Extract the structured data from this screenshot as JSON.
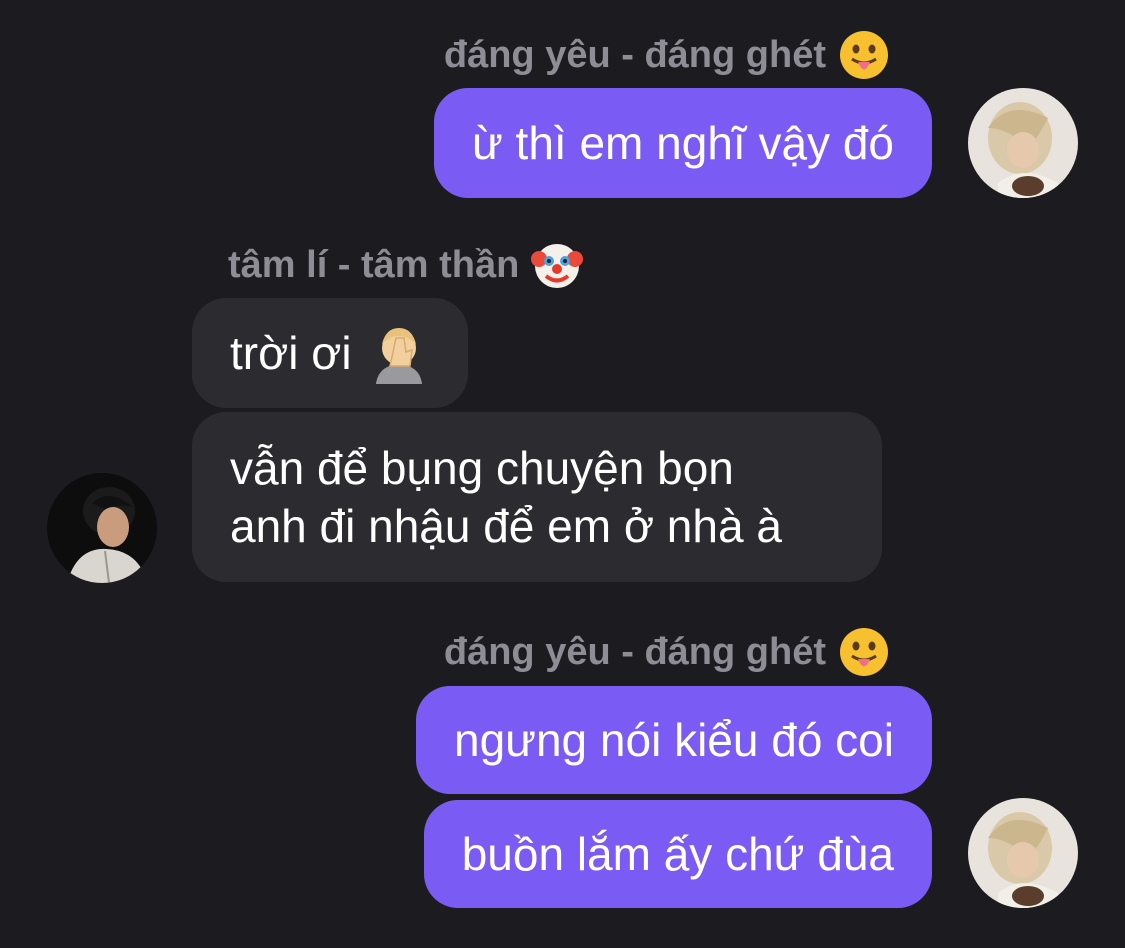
{
  "messages": [
    {
      "sender": "đáng yêu - đáng ghét",
      "sender_emoji": "face-with-tongue-emoji",
      "text": "ừ thì em nghĩ vậy đó"
    },
    {
      "sender": "tâm lí - tâm thần",
      "sender_emoji": "clown-face-emoji",
      "text": "trời ơi",
      "text_emoji": "face-palm-emoji"
    },
    {
      "text_line1": "vẫn để bụng chuyện bọn",
      "text_line2": "anh đi nhậu để em ở nhà à"
    },
    {
      "sender": "đáng yêu - đáng ghét",
      "sender_emoji": "face-with-tongue-emoji",
      "text": "ngưng nói kiểu đó coi"
    },
    {
      "text": "buồn lắm ấy chứ đùa"
    }
  ],
  "colors": {
    "background": "#1c1b20",
    "outgoing_bubble": "#7a5cf4",
    "incoming_bubble": "#2c2c30",
    "sender_name": "#8e8c94",
    "text": "#ffffff"
  }
}
